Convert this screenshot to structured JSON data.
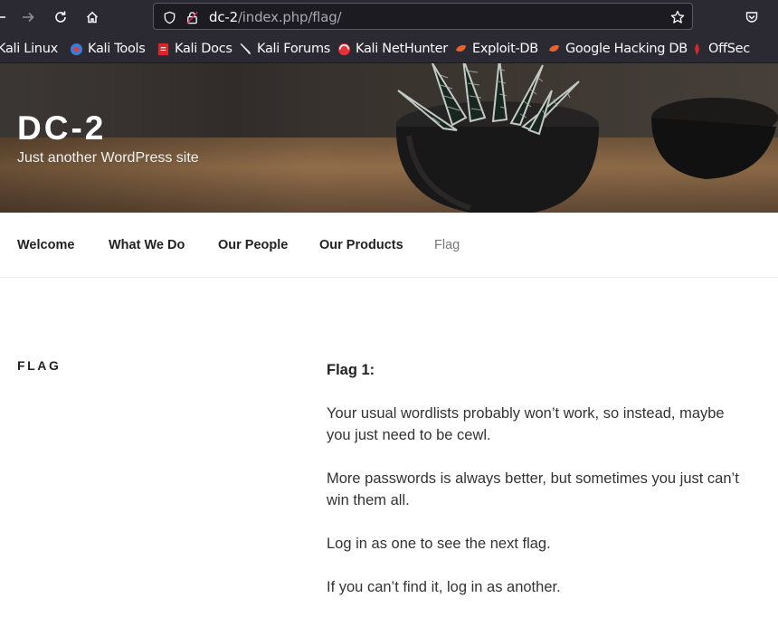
{
  "browser": {
    "url_host": "dc-2",
    "url_path": "/index.php/flag/",
    "bookmarks": [
      {
        "label": "Kali Linux",
        "icon": "kali-icon"
      },
      {
        "label": "Kali Tools",
        "icon": "kali-tools-icon"
      },
      {
        "label": "Kali Docs",
        "icon": "kali-docs-icon"
      },
      {
        "label": "Kali Forums",
        "icon": "kali-forums-icon"
      },
      {
        "label": "Kali NetHunter",
        "icon": "kali-nethunter-icon"
      },
      {
        "label": "Exploit-DB",
        "icon": "exploit-db-icon"
      },
      {
        "label": "Google Hacking DB",
        "icon": "ghdb-icon"
      },
      {
        "label": "OffSec",
        "icon": "offsec-icon"
      }
    ]
  },
  "site": {
    "title": "DC-2",
    "description": "Just another WordPress site"
  },
  "nav": {
    "items": [
      {
        "label": "Welcome"
      },
      {
        "label": "What We Do"
      },
      {
        "label": "Our People"
      },
      {
        "label": "Our Products"
      },
      {
        "label": "Flag"
      }
    ]
  },
  "page": {
    "heading": "FLAG",
    "flag_title": "Flag 1:",
    "paragraphs": [
      "Your usual wordlists probably won’t work, so instead, maybe you just need to be cewl.",
      "More passwords is always better, but sometimes you just can’t win them all.",
      "Log in as one to see the next flag.",
      "If you can’t find it, log in as another."
    ]
  }
}
